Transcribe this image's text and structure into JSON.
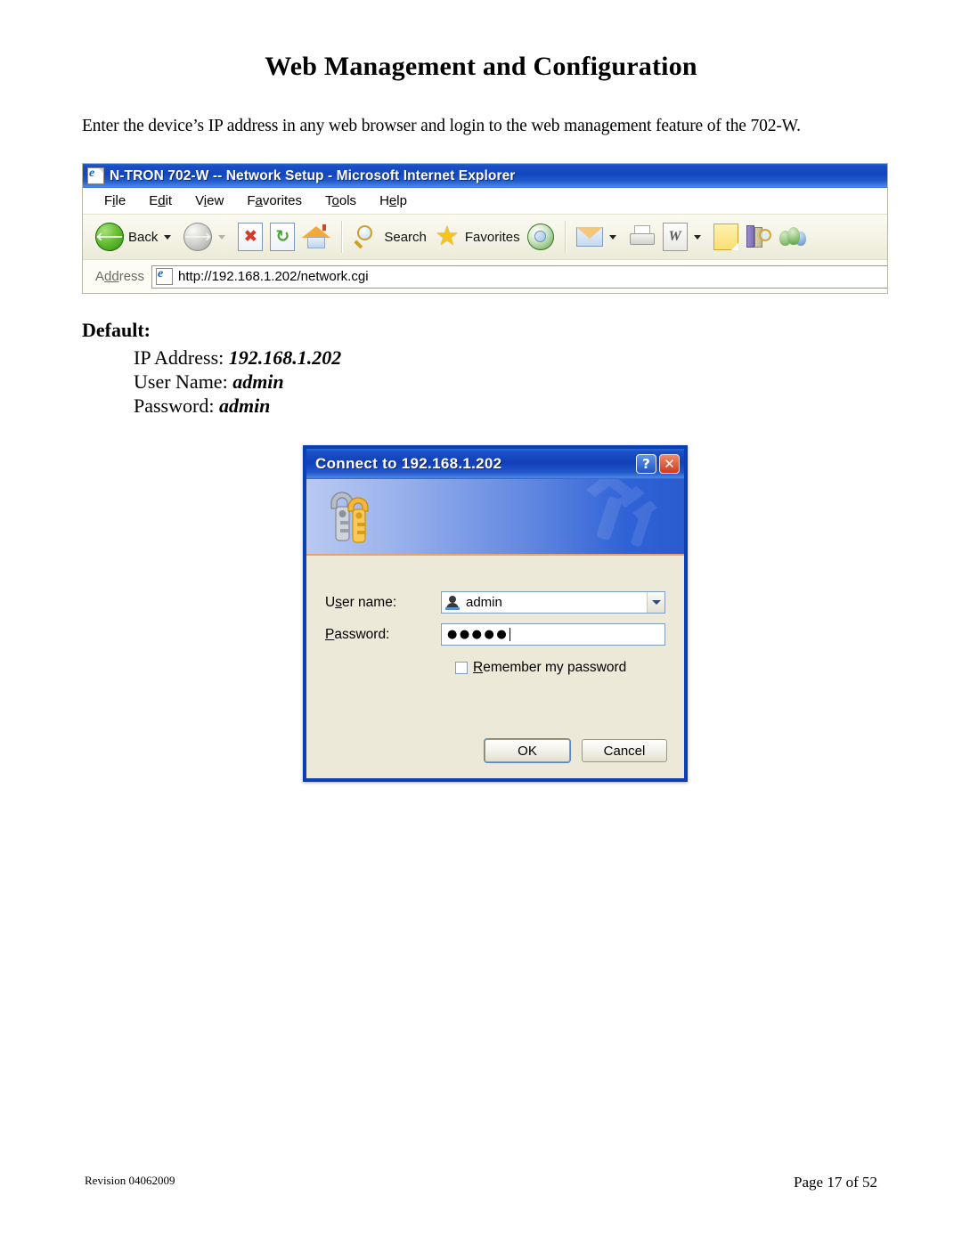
{
  "document": {
    "title": "Web Management and Configuration",
    "intro": "Enter the device’s IP address in any web browser and login to the web management feature of the 702-W.",
    "default_heading": "Default:",
    "defaults": [
      {
        "label": "IP Address:",
        "value": "192.168.1.202"
      },
      {
        "label": "User Name:",
        "value": "admin"
      },
      {
        "label": "Password:",
        "value": "admin"
      }
    ],
    "footer": {
      "revision": "Revision 04062009",
      "page": "Page 17 of 52"
    }
  },
  "browser": {
    "window_title": "N-TRON 702-W -- Network Setup - Microsoft Internet Explorer",
    "title_icon": "ie-page-icon",
    "menu": [
      {
        "name": "file",
        "pre": "F",
        "accel": "i",
        "post": "le"
      },
      {
        "name": "edit",
        "pre": "E",
        "accel": "d",
        "post": "it"
      },
      {
        "name": "view",
        "pre": "V",
        "accel": "i",
        "post": "ew"
      },
      {
        "name": "favorites",
        "pre": "F",
        "accel": "a",
        "post": "vorites"
      },
      {
        "name": "tools",
        "pre": "T",
        "accel": "o",
        "post": "ols"
      },
      {
        "name": "help",
        "pre": "H",
        "accel": "e",
        "post": "lp"
      }
    ],
    "toolbar": {
      "back_label": "Back",
      "search_label": "Search",
      "favorites_label": "Favorites",
      "icons": [
        "back-arrow-icon",
        "forward-arrow-icon",
        "stop-icon",
        "refresh-icon",
        "home-icon",
        "search-icon",
        "favorites-star-icon",
        "media-icon",
        "mail-icon",
        "print-icon",
        "edit-word-icon",
        "notes-icon",
        "research-icon",
        "messenger-icon"
      ]
    },
    "address": {
      "label_pre": "A",
      "label_accel": "dd",
      "label_post": "ress",
      "url": "http://192.168.1.202/network.cgi"
    }
  },
  "dialog": {
    "title": "Connect to 192.168.1.202",
    "help_glyph": "?",
    "close_glyph": "✕",
    "banner_icon": "keys-icon",
    "username": {
      "label_pre": "U",
      "label_accel": "s",
      "label_post": "er name:",
      "value": "admin",
      "icon": "person-icon"
    },
    "password": {
      "label_pre": "",
      "label_accel": "P",
      "label_post": "assword:",
      "value": "●●●●●"
    },
    "remember": {
      "label_pre": "",
      "label_accel": "R",
      "label_post": "emember my password",
      "checked": false
    },
    "buttons": {
      "ok": "OK",
      "cancel": "Cancel"
    }
  },
  "colors": {
    "title_blue": "#123FB8",
    "dialog_face": "#ECE9D8",
    "dialog_border": "#0B3FB5",
    "accent_orange": "#F0A060"
  }
}
